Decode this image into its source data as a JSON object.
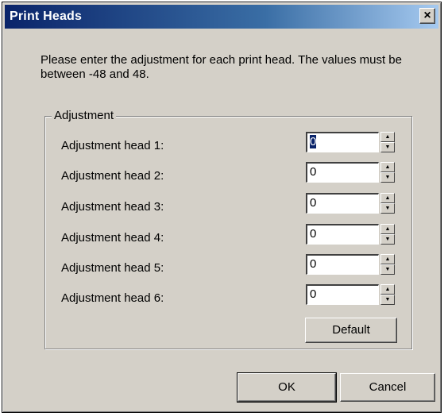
{
  "window": {
    "title": "Print Heads",
    "close_glyph": "×"
  },
  "intro": {
    "text": "Please enter the adjustment for each print head. The values must be between -48 and 48."
  },
  "group": {
    "legend": "Adjustment",
    "rows": [
      {
        "label": "Adjustment head 1:",
        "value": "0",
        "focused": true
      },
      {
        "label": "Adjustment head 2:",
        "value": "0"
      },
      {
        "label": "Adjustment head 3:",
        "value": "0"
      },
      {
        "label": "Adjustment head 4:",
        "value": "0"
      },
      {
        "label": "Adjustment head 5:",
        "value": "0"
      },
      {
        "label": "Adjustment head 6:",
        "value": "0"
      }
    ],
    "default_label": "Default",
    "spin_up_icon": "up-arrow-icon",
    "spin_down_icon": "down-arrow-icon"
  },
  "buttons": {
    "ok_label": "OK",
    "cancel_label": "Cancel"
  },
  "colors": {
    "dialog_face": "#d4d0c8",
    "titlebar_start": "#0a246a",
    "titlebar_end": "#a6caf0"
  }
}
